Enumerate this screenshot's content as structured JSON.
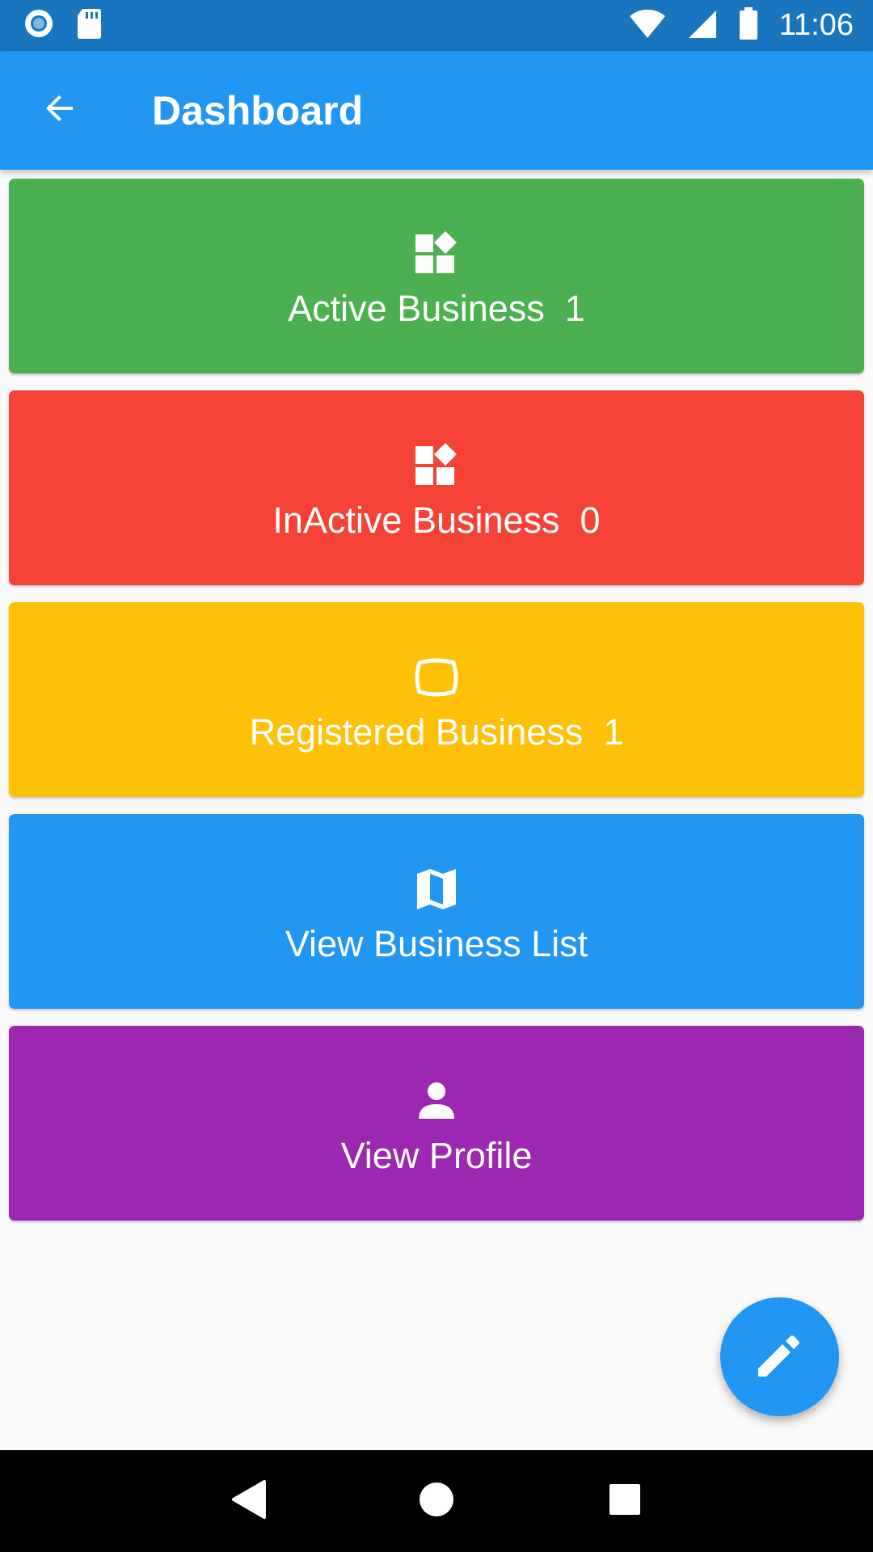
{
  "status_bar": {
    "time": "11:06",
    "icons": [
      "record-icon",
      "sd-card-icon",
      "wifi-icon",
      "signal-icon",
      "battery-icon"
    ]
  },
  "app_bar": {
    "title": "Dashboard",
    "back_icon": "arrow-back-icon"
  },
  "cards": [
    {
      "label": "Active Business  1",
      "icon": "widgets-icon",
      "color": "#4caf50"
    },
    {
      "label": "InActive Business  0",
      "icon": "widgets-icon",
      "color": "#f44336"
    },
    {
      "label": "Registered Business  1",
      "icon": "tv-screen-icon",
      "color": "#ffc107"
    },
    {
      "label": "View Business List",
      "icon": "map-icon",
      "color": "#2196f3"
    },
    {
      "label": "View Profile",
      "icon": "person-icon",
      "color": "#9c27b0"
    }
  ],
  "fab": {
    "icon": "edit-pencil-icon",
    "color": "#2196f3"
  },
  "nav_bar": {
    "icons": [
      "back-triangle-icon",
      "home-circle-icon",
      "recents-square-icon"
    ]
  }
}
